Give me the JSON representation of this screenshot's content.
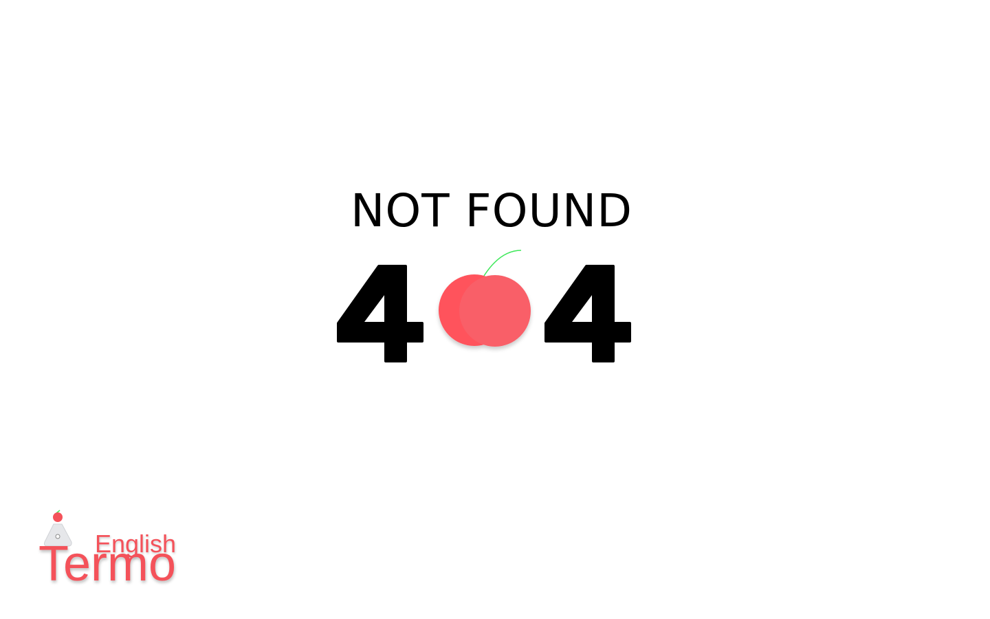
{
  "error": {
    "title": "NOT FOUND",
    "code": "404"
  },
  "logo": {
    "top": "English",
    "bottom": "Termo"
  },
  "colors": {
    "apple_left": "#ff525b",
    "apple_right": "#f95f68",
    "stem": "#3ee85a",
    "text": "#000000",
    "brand": "#f4525a"
  }
}
